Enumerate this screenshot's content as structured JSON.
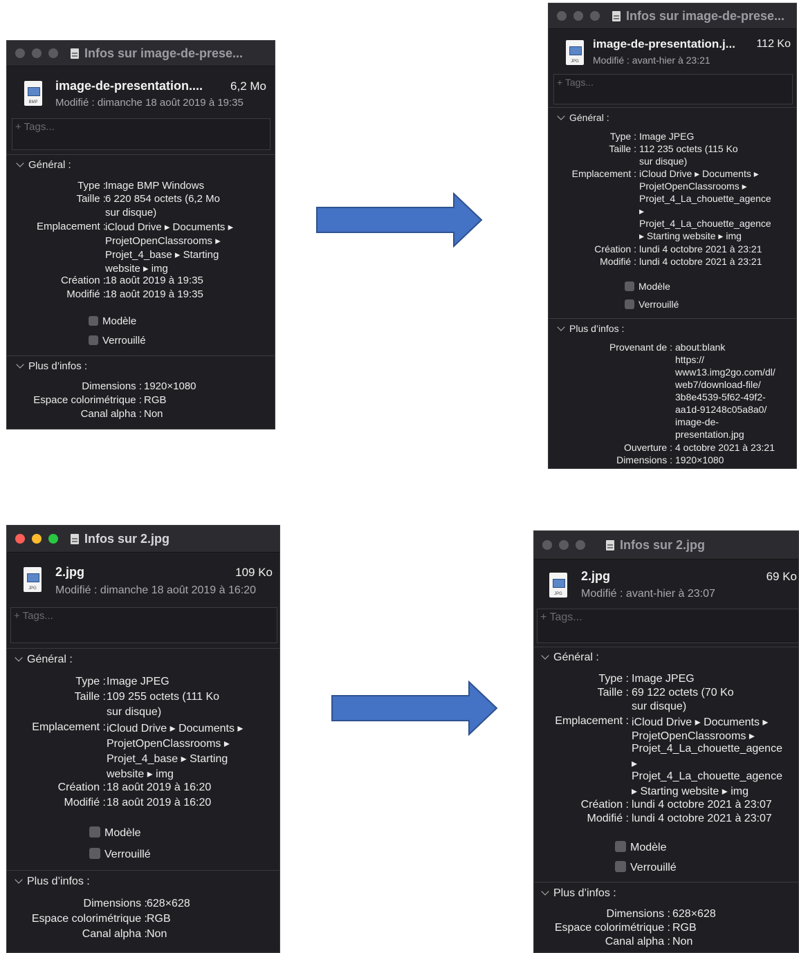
{
  "colors": {
    "window_bg": "#1f1f23",
    "arrow": "#4472c4",
    "arrow_border": "#2f528f"
  },
  "windows": [
    {
      "title": "Infos sur image-de-prese...",
      "file_name": "image-de-presentation....",
      "file_size": "6,2 Mo",
      "file_ext": "BMP",
      "modified": "Modifié : dimanche 18 août 2019 à 19:35",
      "tags_placeholder": "+ Tags...",
      "general_title": "Général :",
      "general_rows": [
        {
          "label": "Type :",
          "lines": [
            "Image BMP Windows"
          ]
        },
        {
          "label": "Taille :",
          "lines": [
            "6 220 854 octets (6,2 Mo",
            "sur disque)"
          ]
        },
        {
          "label": "Emplacement :",
          "lines": [
            "iCloud Drive ▸ Documents ▸",
            "ProjetOpenClassrooms ▸",
            "Projet_4_base ▸ Starting",
            "website ▸ img"
          ]
        },
        {
          "label": "Création :",
          "lines": [
            "18 août 2019 à 19:35"
          ]
        },
        {
          "label": "Modifié :",
          "lines": [
            "18 août 2019 à 19:35"
          ]
        }
      ],
      "checkboxes": [
        "Modèle",
        "Verrouillé"
      ],
      "more_title": "Plus d’infos :",
      "more_rows": [
        {
          "label": "Dimensions :",
          "lines": [
            "1920×1080"
          ]
        },
        {
          "label": "Espace colorimétrique :",
          "lines": [
            "RGB"
          ]
        },
        {
          "label": "Canal alpha :",
          "lines": [
            "Non"
          ]
        }
      ]
    },
    {
      "title": "Infos sur image-de-prese...",
      "file_name": "image-de-presentation.j...",
      "file_size": "112 Ko",
      "file_ext": "JPG",
      "modified": "Modifié : avant-hier à 23:21",
      "tags_placeholder": "+ Tags...",
      "general_title": "Général :",
      "general_rows": [
        {
          "label": "Type :",
          "lines": [
            "Image JPEG"
          ]
        },
        {
          "label": "Taille :",
          "lines": [
            "112 235 octets (115 Ko",
            "sur disque)"
          ]
        },
        {
          "label": "Emplacement :",
          "lines": [
            "iCloud Drive ▸ Documents ▸",
            "ProjetOpenClassrooms ▸",
            "Projet_4_La_chouette_agence",
            "▸",
            "Projet_4_La_chouette_agence",
            "▸ Starting website ▸ img"
          ]
        },
        {
          "label": "Création :",
          "lines": [
            "lundi 4 octobre 2021 à 23:21"
          ]
        },
        {
          "label": "Modifié :",
          "lines": [
            "lundi 4 octobre 2021 à 23:21"
          ]
        }
      ],
      "checkboxes": [
        "Modèle",
        "Verrouillé"
      ],
      "more_title": "Plus d’infos :",
      "more_rows": [
        {
          "label": "Provenant de :",
          "lines": [
            "about:blank",
            "https://",
            "www13.img2go.com/dl/",
            "web7/download-file/",
            "3b8e4539-5f62-49f2-",
            "aa1d-91248c05a8a0/",
            "image-de-",
            "presentation.jpg"
          ]
        },
        {
          "label": "Ouverture :",
          "lines": [
            "4 octobre 2021 à 23:21"
          ]
        },
        {
          "label": "Dimensions :",
          "lines": [
            "1920×1080"
          ]
        }
      ]
    },
    {
      "title": "Infos sur 2.jpg",
      "file_name": "2.jpg",
      "file_size": "109 Ko",
      "file_ext": "JPG",
      "modified": "Modifié : dimanche 18 août 2019 à 16:20",
      "tags_placeholder": "+ Tags...",
      "general_title": "Général :",
      "general_rows": [
        {
          "label": "Type :",
          "lines": [
            "Image JPEG"
          ]
        },
        {
          "label": "Taille :",
          "lines": [
            "109 255 octets (111 Ko",
            "sur disque)"
          ]
        },
        {
          "label": "Emplacement :",
          "lines": [
            "iCloud Drive ▸ Documents ▸",
            "ProjetOpenClassrooms ▸",
            "Projet_4_base ▸ Starting",
            "website ▸ img"
          ]
        },
        {
          "label": "Création :",
          "lines": [
            "18 août 2019 à 16:20"
          ]
        },
        {
          "label": "Modifié :",
          "lines": [
            "18 août 2019 à 16:20"
          ]
        }
      ],
      "checkboxes": [
        "Modèle",
        "Verrouillé"
      ],
      "more_title": "Plus d’infos :",
      "more_rows": [
        {
          "label": "Dimensions :",
          "lines": [
            "628×628"
          ]
        },
        {
          "label": "Espace colorimétrique :",
          "lines": [
            "RGB"
          ]
        },
        {
          "label": "Canal alpha :",
          "lines": [
            "Non"
          ]
        }
      ]
    },
    {
      "title": "Infos sur 2.jpg",
      "file_name": "2.jpg",
      "file_size": "69 Ko",
      "file_ext": "JPG",
      "modified": "Modifié : avant-hier à 23:07",
      "tags_placeholder": "+ Tags...",
      "general_title": "Général :",
      "general_rows": [
        {
          "label": "Type :",
          "lines": [
            "Image JPEG"
          ]
        },
        {
          "label": "Taille :",
          "lines": [
            "69 122 octets (70 Ko",
            "sur disque)"
          ]
        },
        {
          "label": "Emplacement :",
          "lines": [
            "iCloud Drive ▸ Documents ▸",
            "ProjetOpenClassrooms ▸",
            "Projet_4_La_chouette_agence",
            "▸",
            "Projet_4_La_chouette_agence",
            "▸ Starting website ▸ img"
          ]
        },
        {
          "label": "Création :",
          "lines": [
            "lundi 4 octobre 2021 à 23:07"
          ]
        },
        {
          "label": "Modifié :",
          "lines": [
            "lundi 4 octobre 2021 à 23:07"
          ]
        }
      ],
      "checkboxes": [
        "Modèle",
        "Verrouillé"
      ],
      "more_title": "Plus d’infos :",
      "more_rows": [
        {
          "label": "Dimensions :",
          "lines": [
            "628×628"
          ]
        },
        {
          "label": "Espace colorimétrique :",
          "lines": [
            "RGB"
          ]
        },
        {
          "label": "Canal alpha :",
          "lines": [
            "Non"
          ]
        }
      ]
    }
  ]
}
